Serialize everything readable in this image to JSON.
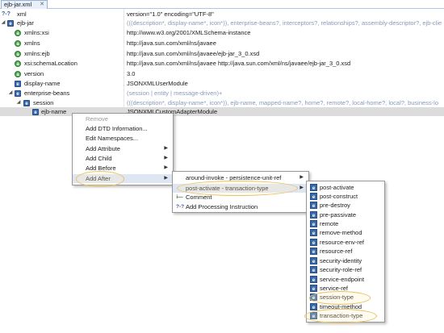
{
  "tab": {
    "title": "ejb-jar.xml",
    "close_glyph": "✕"
  },
  "tree": [
    {
      "name": "xml",
      "value": "version=\"1.0\" encoding=\"UTF-8\"",
      "icon": "processing-instruction-icon",
      "hint": false
    },
    {
      "name": "ejb-jar",
      "value": "(((description*, display-name*, icon*)), enterprise-beans?, interceptors?, relationships?, assembly-descriptor?, ejb-clie",
      "icon": "element-icon",
      "hint": true
    },
    {
      "name": "xmlns:xsi",
      "value": "http://www.w3.org/2001/XMLSchema-instance",
      "icon": "attribute-icon",
      "hint": false
    },
    {
      "name": "xmlns",
      "value": "http://java.sun.com/xml/ns/javaee",
      "icon": "attribute-icon",
      "hint": false
    },
    {
      "name": "xmlns:ejb",
      "value": "http://java.sun.com/xml/ns/javaee/ejb-jar_3_0.xsd",
      "icon": "attribute-icon",
      "hint": false
    },
    {
      "name": "xsi:schemaLocation",
      "value": "http://java.sun.com/xml/ns/javaee http://java.sun.com/xml/ns/javaee/ejb-jar_3_0.xsd",
      "icon": "attribute-icon",
      "hint": false
    },
    {
      "name": "version",
      "value": "3.0",
      "icon": "attribute-icon",
      "hint": false
    },
    {
      "name": "display-name",
      "value": "JSONXMLUserModule",
      "icon": "element-icon",
      "hint": false
    },
    {
      "name": "enterprise-beans",
      "value": "(session | entity | message-driven)+",
      "icon": "element-icon",
      "hint": true
    },
    {
      "name": "session",
      "value": "(((description*, display-name*, icon*)), ejb-name, mapped-name?, home?, remote?, local-home?, local?, business-lo",
      "icon": "element-icon",
      "hint": true
    },
    {
      "name": "ejb-name",
      "value": "JSONXMLCustomAdapterModule",
      "icon": "element-icon",
      "hint": false
    }
  ],
  "context_menu": {
    "items": [
      {
        "label": "Remove",
        "disabled": true,
        "submenu": false
      },
      {
        "label": "Add DTD Information...",
        "disabled": false,
        "submenu": false
      },
      {
        "label": "Edit Namespaces...",
        "disabled": false,
        "submenu": false
      },
      {
        "label": "Add Attribute",
        "disabled": false,
        "submenu": true
      },
      {
        "label": "Add Child",
        "disabled": false,
        "submenu": true
      },
      {
        "label": "Add Before",
        "disabled": false,
        "submenu": true
      },
      {
        "label": "Add After",
        "disabled": false,
        "submenu": true
      }
    ]
  },
  "add_after_menu": {
    "items": [
      {
        "label": "around-invoke - persistence-unit-ref",
        "icon": "element-icon",
        "submenu": true
      },
      {
        "label": "post-activate - transaction-type",
        "icon": "element-icon",
        "submenu": true
      },
      {
        "label": "Comment",
        "icon": "comment-icon",
        "submenu": false
      },
      {
        "label": "Add Processing Instruction",
        "icon": "processing-instruction-icon",
        "submenu": false
      }
    ]
  },
  "elements_menu": {
    "items": [
      "post-activate",
      "post-construct",
      "pre-destroy",
      "pre-passivate",
      "remote",
      "remove-method",
      "resource-env-ref",
      "resource-ref",
      "security-identity",
      "security-role-ref",
      "service-endpoint",
      "service-ref",
      "session-type",
      "timeout-method",
      "transaction-type"
    ]
  }
}
